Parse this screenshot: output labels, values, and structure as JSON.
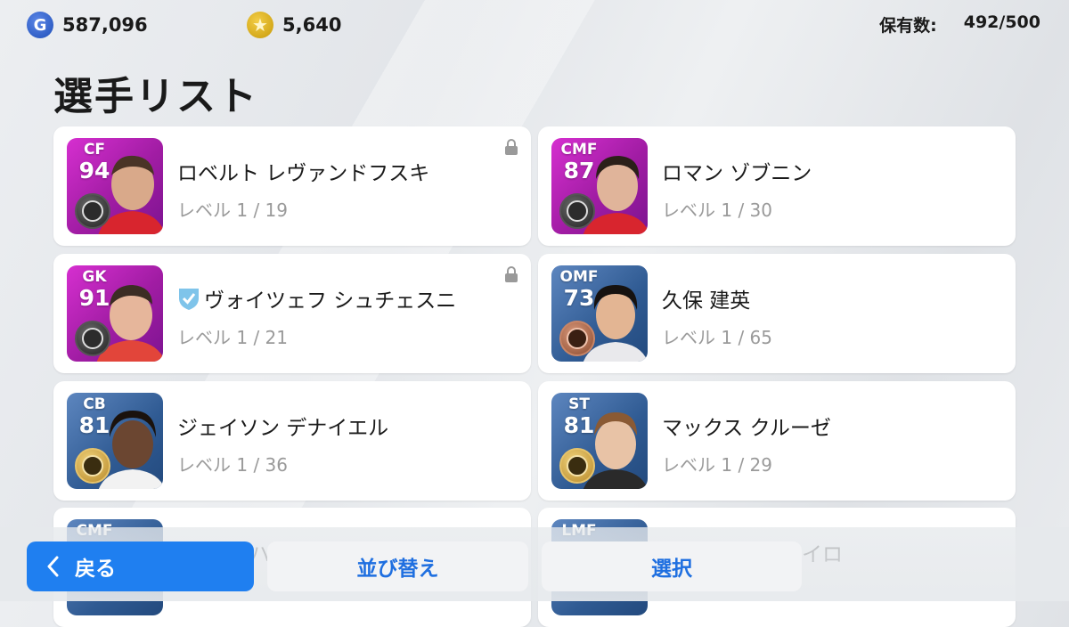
{
  "currency": {
    "gp": {
      "icon": "g-coin-icon",
      "letter": "G",
      "value": "587,096"
    },
    "coins": {
      "icon": "star-coin-icon",
      "value": "5,640"
    }
  },
  "stock": {
    "label": "保有数:",
    "value": "492/500"
  },
  "page_title": "選手リスト",
  "players": [
    {
      "position": "CF",
      "rating": "94",
      "name": "ロベルト レヴァンドフスキ",
      "level": "レベル 1 / 19",
      "locked": true,
      "favorite": false,
      "card_color": "pink",
      "badge": "dark"
    },
    {
      "position": "CMF",
      "rating": "87",
      "name": "ロマン ゾブニン",
      "level": "レベル 1 / 30",
      "locked": false,
      "favorite": false,
      "card_color": "pink",
      "badge": "dark"
    },
    {
      "position": "GK",
      "rating": "91",
      "name": "ヴォイツェフ シュチェスニ",
      "level": "レベル 1 / 21",
      "locked": true,
      "favorite": true,
      "card_color": "pink",
      "badge": "dark"
    },
    {
      "position": "OMF",
      "rating": "73",
      "name": "久保 建英",
      "level": "レベル 1 / 65",
      "locked": false,
      "favorite": false,
      "card_color": "blue",
      "badge": "bronze"
    },
    {
      "position": "CB",
      "rating": "81",
      "name": "ジェイソン デナイエル",
      "level": "レベル 1 / 36",
      "locked": false,
      "favorite": false,
      "card_color": "blue",
      "badge": "gold"
    },
    {
      "position": "ST",
      "rating": "81",
      "name": "マックス クルーゼ",
      "level": "レベル 1 / 29",
      "locked": false,
      "favorite": false,
      "card_color": "blue",
      "badge": "gold"
    },
    {
      "position": "CMF",
      "rating": "",
      "name": "ハ",
      "level": "",
      "locked": false,
      "favorite": false,
      "card_color": "blue",
      "badge": "dark"
    },
    {
      "position": "LMF",
      "rating": "",
      "name": "イロ",
      "level": "",
      "locked": false,
      "favorite": false,
      "card_color": "blue",
      "badge": "dark"
    }
  ],
  "buttons": {
    "back": "戻る",
    "sort": "並び替え",
    "select": "選択"
  },
  "colors": {
    "accent_blue": "#1f7ff0",
    "button_text_blue": "#1f6fe0",
    "card_pink": "#a01ca3",
    "card_blue": "#2f5a92"
  }
}
